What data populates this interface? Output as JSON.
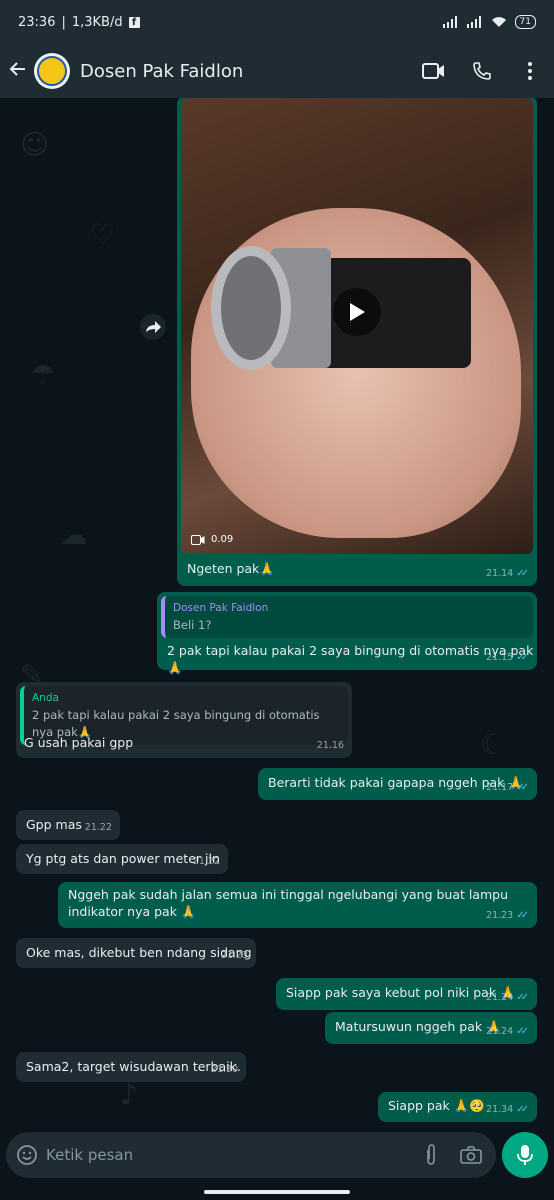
{
  "status_bar": {
    "time": "23:36",
    "network": "1,3KB/d",
    "battery": "71"
  },
  "header": {
    "contact_name": "Dosen Pak Faidlon"
  },
  "messages": {
    "m1": {
      "video_duration": "0.09",
      "text": "Ngeten pak🙏",
      "time": "21.14"
    },
    "m2": {
      "quote_name": "Dosen Pak Faidlon",
      "quote_text": "Beli 1?",
      "text": "2 pak tapi kalau pakai 2 saya bingung di otomatis nya pak🙏",
      "time": "21.15"
    },
    "m3": {
      "quote_name": "Anda",
      "quote_text": "2 pak tapi kalau pakai 2 saya bingung di otomatis nya pak🙏",
      "text": "G usah pakai gpp",
      "time": "21.16"
    },
    "m4": {
      "text": "Berarti tidak pakai gapapa nggeh pak 🙏",
      "time": "21.17"
    },
    "m5": {
      "text": "Gpp mas",
      "time": "21.22"
    },
    "m6": {
      "text": "Yg ptg ats dan power meter jln",
      "time": "21.22"
    },
    "m7": {
      "text": "Nggeh pak sudah jalan semua ini tinggal ngelubangi yang buat lampu indikator nya pak 🙏",
      "time": "21.23"
    },
    "m8": {
      "text": "Oke mas, dikebut ben ndang sidang",
      "time": "21.23"
    },
    "m9": {
      "text": "Siapp pak saya kebut pol niki pak 🙏",
      "time": "21.24"
    },
    "m10": {
      "text": "Matursuwun nggeh pak 🙏",
      "time": "21.24"
    },
    "m11": {
      "text": "Sama2, target wisudawan terbaik.",
      "time": "21.30"
    },
    "m12": {
      "text": "Siapp pak 🙏🥺",
      "time": "21.34"
    }
  },
  "composer": {
    "placeholder": "Ketik pesan"
  },
  "icons": [
    "back-arrow-icon",
    "video-call-icon",
    "phone-icon",
    "more-icon",
    "forward-icon",
    "play-icon",
    "video-icon",
    "emoji-icon",
    "attach-icon",
    "camera-icon",
    "mic-icon"
  ],
  "colors": {
    "outgoing_bubble": "#005c4b",
    "incoming_bubble": "#202c33",
    "read_tick": "#53bdeb",
    "accent": "#00a884"
  }
}
